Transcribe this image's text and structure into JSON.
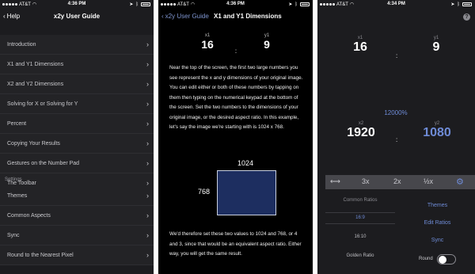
{
  "status": {
    "carrier": "AT&T",
    "time1": "4:36 PM",
    "time2": "4:36 PM",
    "time3": "4:34 PM"
  },
  "screen1": {
    "back_label": "Help",
    "title": "x2y User Guide",
    "items": [
      {
        "label": "Introduction"
      },
      {
        "label": "X1 and Y1 Dimensions"
      },
      {
        "label": "X2 and Y2 Dimensions"
      },
      {
        "label": "Solving for X or Solving for Y"
      },
      {
        "label": "Percent"
      },
      {
        "label": "Copying Your Results"
      },
      {
        "label": "Gestures on the Number Pad"
      },
      {
        "label": "The Toolbar"
      }
    ],
    "settings_header": "Settings",
    "settings_items": [
      {
        "label": "Themes"
      },
      {
        "label": "Common Aspects"
      },
      {
        "label": "Sync"
      },
      {
        "label": "Round to the Nearest Pixel"
      }
    ]
  },
  "screen2": {
    "back_label": "x2y User Guide",
    "title": "X1 and Y1 Dimensions",
    "x_label": "x1",
    "y_label": "y1",
    "x_value": "16",
    "colon": ":",
    "y_value": "9",
    "paragraph1": "Near the top of the screen, the first two large numbers you see represent the x and y dimensions of your original image. You can edit either or both of these numbers by tapping on them then typing on the numerical keypad at the bottom of the screen. Set the two numbers to the dimensions of your original image, or the desired aspect ratio. In this example, let's say the image we're starting with is 1024 x 768.",
    "width_label": "1024",
    "height_label": "768",
    "paragraph2": "We'd therefore set these two values to 1024 and 768, or 4 and 3, since that would be an equivalent aspect ratio. Either way, you will get the same result."
  },
  "screen3": {
    "x1_label": "x1",
    "y1_label": "y1",
    "x1_value": "16",
    "y1_value": "9",
    "colon": ":",
    "percent": "12000%",
    "x2_label": "x2",
    "y2_label": "y2",
    "x2_value": "1920",
    "y2_value": "1080",
    "toolbar": {
      "btn_3x": "3x",
      "btn_2x": "2x",
      "btn_half": "½x"
    },
    "picker_header": "Common Ratios",
    "picker_items": [
      "16:9",
      "16:10",
      "Golden Ratio"
    ],
    "links": [
      "Themes",
      "Edit Ratios",
      "Sync"
    ],
    "round_label": "Round",
    "round_on": false
  },
  "colors": {
    "accent": "#6e8bd6",
    "bg_dark": "#1c1c1f",
    "rect_fill": "#1d2e60"
  }
}
